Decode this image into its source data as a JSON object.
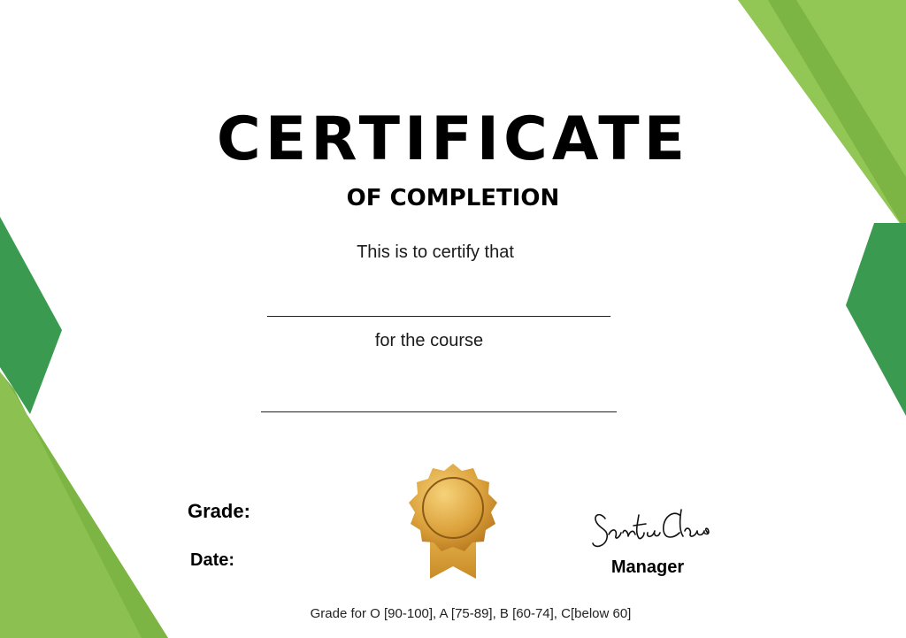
{
  "certificate": {
    "title": "CERTIFICATE",
    "subtitle": "OF COMPLETION",
    "certify_text": "This is to certify that",
    "course_text": "for the course",
    "grade_label": "Grade:",
    "date_label": "Date:",
    "signer_title": "Manager",
    "signature_text": "Santa Claus",
    "grading_scale": "Grade for O [90-100], A [75-89], B [60-74], C[below 60]"
  },
  "colors": {
    "light_green": "#8cc152",
    "dark_green": "#3a9a4f",
    "gold": "#d9a23a",
    "text": "#000000"
  }
}
